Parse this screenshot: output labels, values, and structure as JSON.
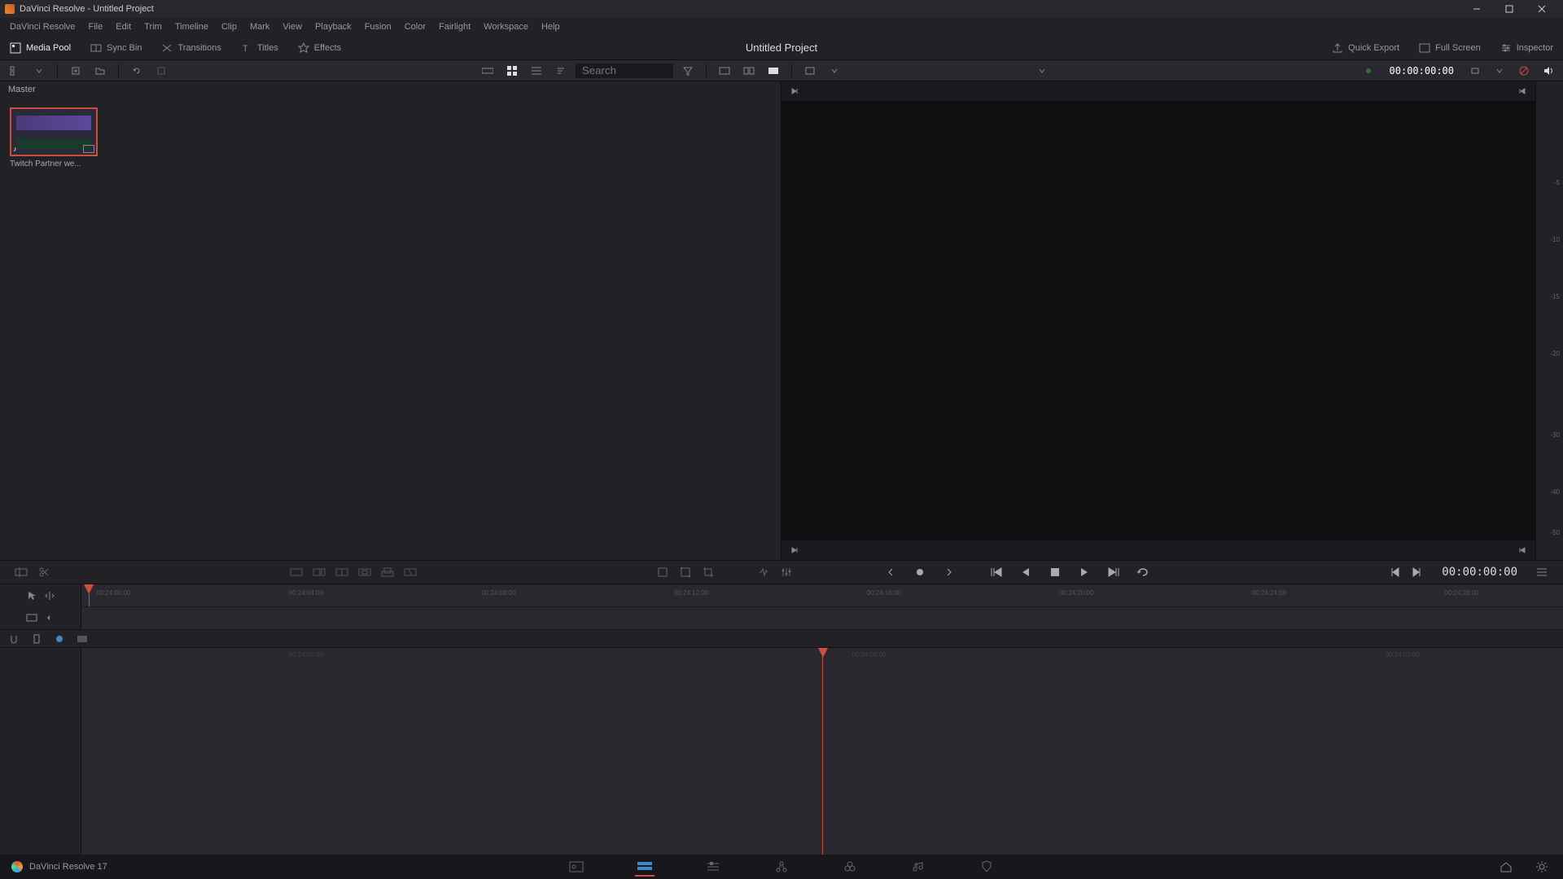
{
  "window": {
    "title": "DaVinci Resolve - Untitled Project"
  },
  "menu": [
    "DaVinci Resolve",
    "File",
    "Edit",
    "Trim",
    "Timeline",
    "Clip",
    "Mark",
    "View",
    "Playback",
    "Fusion",
    "Color",
    "Fairlight",
    "Workspace",
    "Help"
  ],
  "workspace": {
    "left": [
      {
        "label": "Media Pool",
        "active": true
      },
      {
        "label": "Sync Bin",
        "active": false
      },
      {
        "label": "Transitions",
        "active": false
      },
      {
        "label": "Titles",
        "active": false
      },
      {
        "label": "Effects",
        "active": false
      }
    ],
    "title": "Untitled Project",
    "right": [
      {
        "label": "Quick Export"
      },
      {
        "label": "Full Screen"
      },
      {
        "label": "Inspector"
      }
    ]
  },
  "toolbar": {
    "search_placeholder": "Search",
    "timecode": "00:00:00:00"
  },
  "media": {
    "breadcrumb": "Master",
    "items": [
      {
        "label": "Twitch Partner we..."
      }
    ]
  },
  "audio_scale": [
    "-5",
    "-10",
    "-15",
    "-20",
    "-30",
    "-40",
    "-50"
  ],
  "transport": {
    "timecode": "00:00:00:00"
  },
  "ruler": {
    "row1": [
      "00:24:00:00",
      "00:24:04:00",
      "00:24:08:00",
      "00:24:12:00",
      "00:24:16:00",
      "00:24:20:00",
      "00:24:24:00",
      "00:24:28:00"
    ],
    "playhead1_pct": 0.5,
    "row2": [
      "00:24:00:00",
      "00:24:02:00"
    ],
    "playhead2_pct": 50
  },
  "bottom": {
    "version": "DaVinci Resolve 17"
  }
}
